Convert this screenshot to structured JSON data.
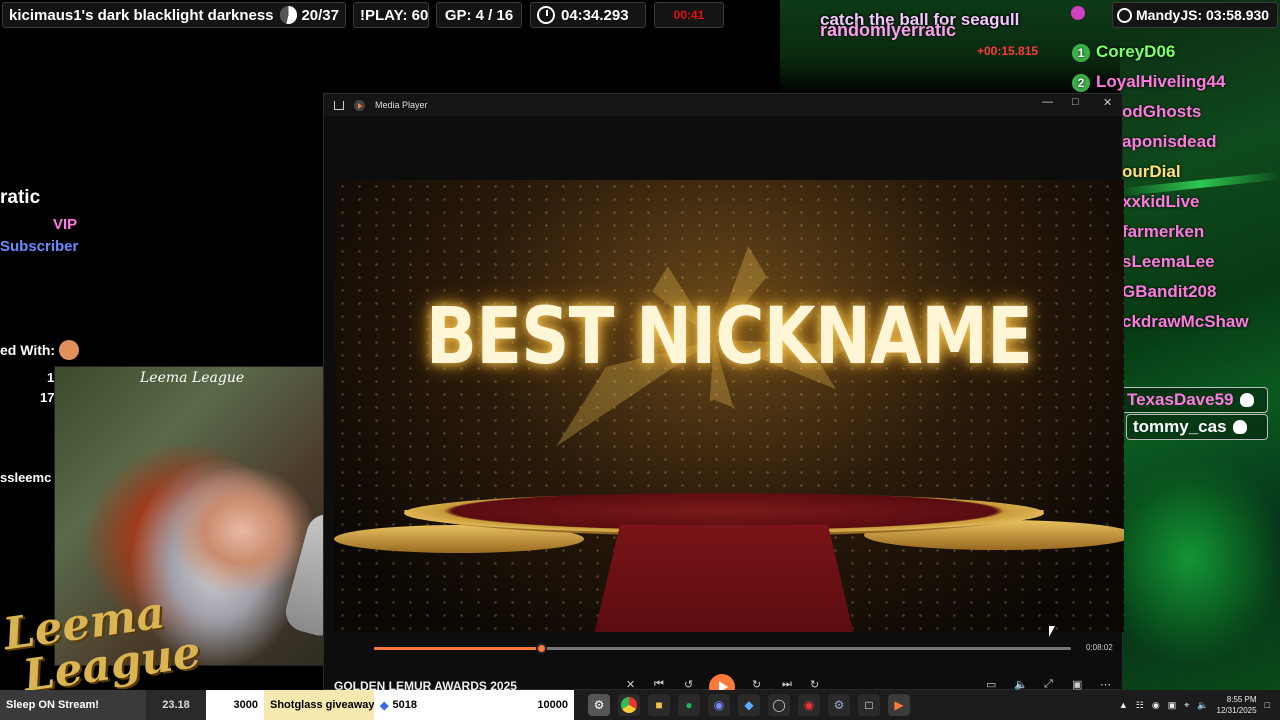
{
  "hud": {
    "title": "kicimaus1's dark blacklight darkness",
    "progress": "20/37",
    "play": "!PLAY: 60",
    "gp": "GP: 4 / 16",
    "timer": "04:34.293",
    "red_timer": "00:41",
    "mandy": "MandyJS: 03:58.930"
  },
  "overlay": {
    "user_top": "randomlyerratic",
    "user_top_behind": "catch the ball for seagull",
    "delta": "+00:15.815"
  },
  "leaderboard": [
    {
      "rank": "1",
      "name": "CoreyD06",
      "color": "#7dff6a"
    },
    {
      "rank": "2",
      "name": "LoyalHiveling44",
      "color": "#ff7ae0"
    },
    {
      "name": "odGhosts",
      "color": "#ff7ae0"
    },
    {
      "name": "aponisdead",
      "color": "#ff7ae0"
    },
    {
      "name": "ourDial",
      "color": "#ffe07a"
    },
    {
      "name": "xxkidLive",
      "color": "#ff7ae0"
    },
    {
      "name": "farmerken",
      "color": "#ff7ae0"
    },
    {
      "name": "sLeemaLee",
      "color": "#ff7ae0"
    },
    {
      "name": "GBandit208",
      "color": "#ff7ae0"
    },
    {
      "name": "ckdrawMcShaw",
      "color": "#ff7ae0"
    }
  ],
  "chips": [
    "TexasDave59",
    "tommy_cas"
  ],
  "left": {
    "ratic": "ratic",
    "vip": "VIP",
    "subscriber": "Subscriber",
    "played_with": "ed With:",
    "n1": "1",
    "n17": "17",
    "ssleemc": "ssleemc"
  },
  "cam": {
    "sign": "Leema League",
    "logo_line1": "Leema",
    "logo_line2": "League"
  },
  "media_player": {
    "app_title": "Media Player",
    "video_text": "BEST NICKNAME",
    "duration": "0:08:02",
    "progress": 0.24,
    "now_playing": "GOLDEN LEMUR AWARDS 2025"
  },
  "taskbar": {
    "sleep": "Sleep ON Stream!",
    "sleep_val": "23.18",
    "n3000": "3000",
    "shotglass": "Shotglass giveaway",
    "n5018": "5018",
    "n10000": "10000",
    "time": "8:55 PM",
    "date": "12/31/2025"
  }
}
